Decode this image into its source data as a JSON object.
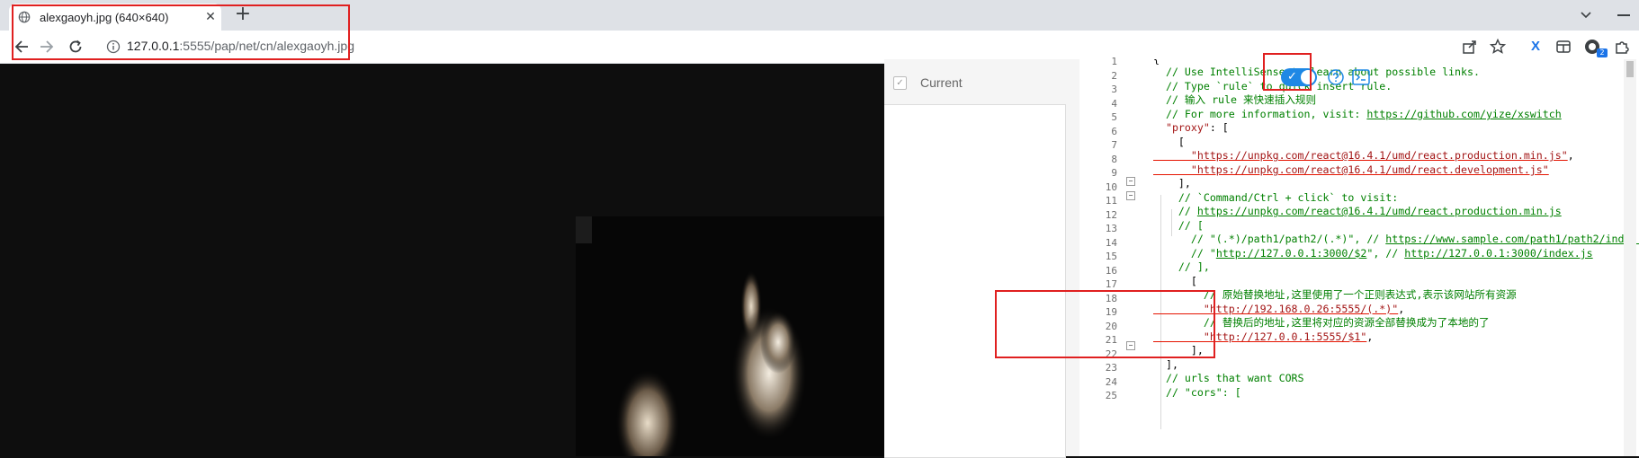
{
  "browser": {
    "tab": {
      "title": "alexgaoyh.jpg (640×640)"
    },
    "address_bar": {
      "url_host": "127.0.0.1",
      "url_rest": ":5555/pap/net/cn/alexgaoyh.jpg"
    },
    "extension_badge": "2"
  },
  "xswitch": {
    "current_label": "Current",
    "toggle_on": true,
    "line_numbers": [
      "1",
      "2",
      "3",
      "4",
      "5",
      "6",
      "7",
      "8",
      "9",
      "10",
      "11",
      "12",
      "13",
      "14",
      "15",
      "16",
      "17",
      "18",
      "19",
      "20",
      "21",
      "22",
      "23",
      "24",
      "25"
    ],
    "code": {
      "l1": "{",
      "l2": "  // Use IntelliSense to learn about possible links.",
      "l3": "  // Type `rule` to quick insert rule.",
      "l4": "  // 输入 rule 来快速插入规则",
      "l5a": "  // For more information, visit: ",
      "l5b": "https://github.com/yize/xswitch",
      "l6a": "  \"proxy\"",
      "l6b": ": [",
      "l7": "    [",
      "l8a": "      \"https://unpkg.com/react@16.4.1/umd/react.production.min.js\"",
      "l8b": ",",
      "l9": "      \"https://unpkg.com/react@16.4.1/umd/react.development.js\"",
      "l10": "    ],",
      "l11": "    // `Command/Ctrl + click` to visit:",
      "l12a": "    // ",
      "l12b": "https://unpkg.com/react@16.4.1/umd/react.production.min.js",
      "l13": "    // [",
      "l14a": "      // \"(.*)/path1/path2/(.*)\", // ",
      "l14b": "https://www.sample.com/path1/path2/index.js",
      "l15a": "      // \"",
      "l15b": "http://127.0.0.1:3000/$2",
      "l15c": "\", // ",
      "l15d": "http://127.0.0.1:3000/index.js",
      "l16": "    // ],",
      "l17": "      [",
      "l18": "        // 原始替换地址,这里使用了一个正则表达式,表示该网站所有资源",
      "l19a": "        \"http://192.168.0.26:5555/(.*)\"",
      "l19b": ",",
      "l20": "        // 替换后的地址,这里将对应的资源全部替换成为了本地的了",
      "l21a": "        \"http://127.0.0.1:5555/$1\"",
      "l21b": ",",
      "l22": "      ],",
      "l23": "  ],",
      "l24": "  // urls that want CORS",
      "l25a": "  // \"cors\": ["
    }
  },
  "colors": {
    "highlight_box": "#e02020",
    "toggle": "#1e88e5",
    "comment": "#008000",
    "string": "#a31515"
  }
}
